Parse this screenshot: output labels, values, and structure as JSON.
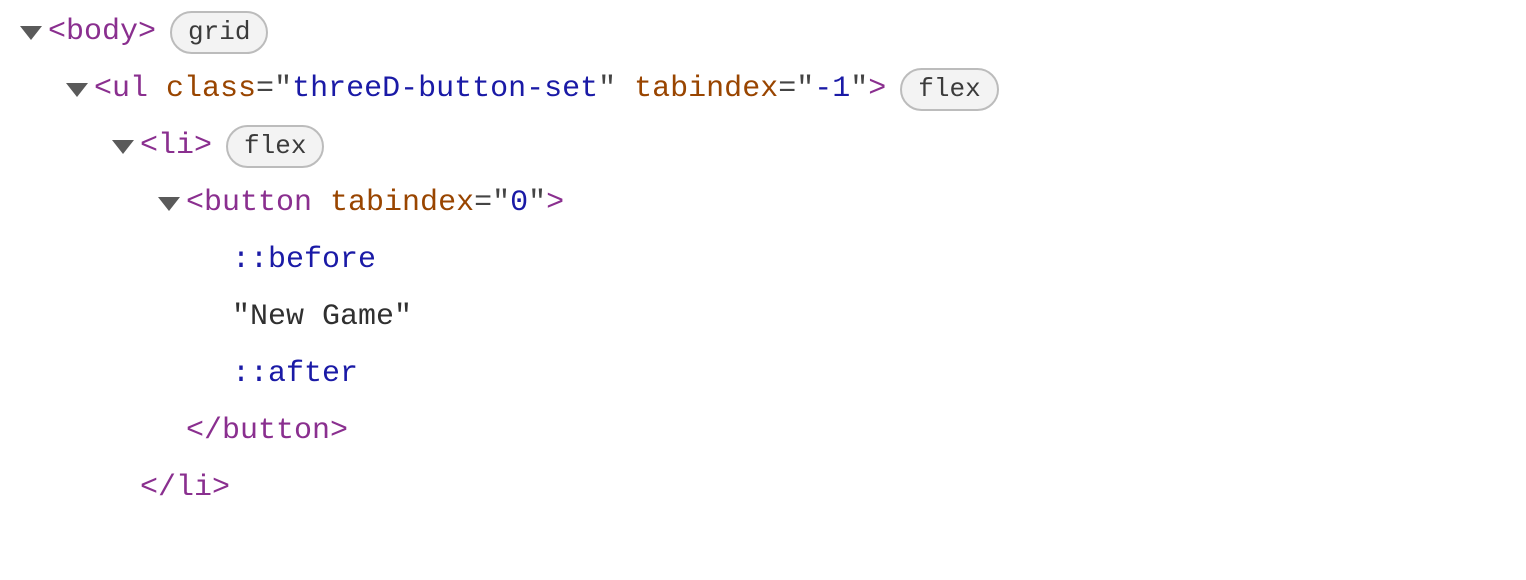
{
  "tree": {
    "body": {
      "open_tag": "<body>",
      "badge": "grid"
    },
    "ul": {
      "open_prefix": "<ul",
      "attr_class_name": "class",
      "eq": "=",
      "q": "\"",
      "attr_class_value": "threeD-button-set",
      "attr_tabindex_name": "tabindex",
      "attr_tabindex_value": "-1",
      "close_bracket": ">",
      "badge": "flex"
    },
    "li": {
      "open_tag": "<li>",
      "badge": "flex",
      "close_tag": "</li>"
    },
    "button": {
      "open_prefix": "<button",
      "attr_tabindex_name": "tabindex",
      "attr_tabindex_value": "0",
      "close_bracket": ">",
      "close_tag": "</button>"
    },
    "pseudo_before": "::before",
    "text_node": "\"New Game\"",
    "pseudo_after": "::after"
  }
}
